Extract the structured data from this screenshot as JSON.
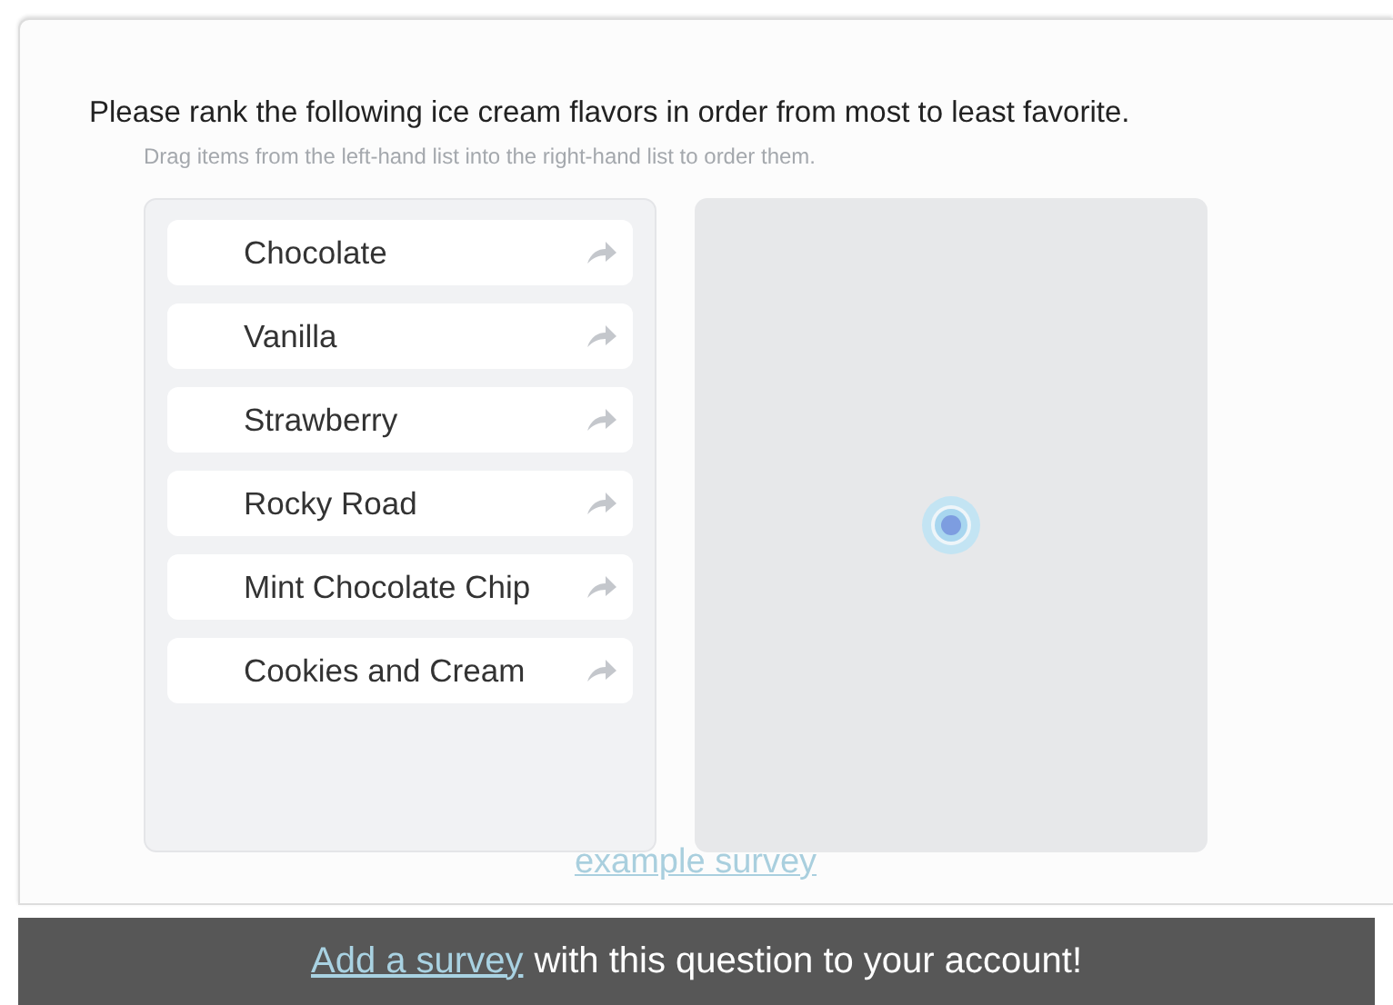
{
  "question": {
    "title": "Please rank the following ice cream flavors in order from most to least favorite.",
    "hint": "Drag items from the left-hand list into the right-hand list to order them."
  },
  "source_list": [
    {
      "label": "Chocolate"
    },
    {
      "label": "Vanilla"
    },
    {
      "label": "Strawberry"
    },
    {
      "label": "Rocky Road"
    },
    {
      "label": "Mint Chocolate Chip"
    },
    {
      "label": "Cookies and Cream"
    }
  ],
  "target_list": {
    "loading": true
  },
  "example_link": "example survey",
  "banner": {
    "link": "Add a survey",
    "text": "with this question to your account!"
  }
}
